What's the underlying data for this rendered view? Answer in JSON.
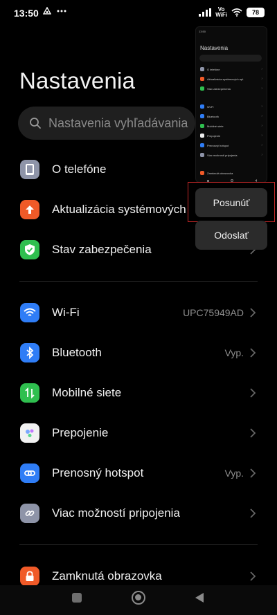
{
  "status_bar": {
    "time": "13:50",
    "network_label_top": "Vo",
    "network_label_bottom": "WiFi",
    "battery": "78"
  },
  "page": {
    "title": "Nastavenia",
    "search_placeholder": "Nastavenia vyhľadávania"
  },
  "sections": [
    {
      "items": [
        {
          "label": "O telefóne",
          "value": "",
          "icon": "phone-icon",
          "color": "#8e94a8"
        },
        {
          "label": "Aktualizácia systémových",
          "value": "",
          "icon": "arrow-up-icon",
          "color": "#f05a28"
        },
        {
          "label": "Stav zabezpečenia",
          "value": "",
          "icon": "shield-check-icon",
          "color": "#2fbf4f"
        }
      ]
    },
    {
      "items": [
        {
          "label": "Wi-Fi",
          "value": "UPC75949AD",
          "icon": "wifi-icon",
          "color": "#2f7df6"
        },
        {
          "label": "Bluetooth",
          "value": "Vyp.",
          "icon": "bluetooth-icon",
          "color": "#2f7df6"
        },
        {
          "label": "Mobilné siete",
          "value": "",
          "icon": "mobile-data-icon",
          "color": "#2fbf4f"
        },
        {
          "label": "Prepojenie",
          "value": "",
          "icon": "connection-icon",
          "color": "#f2f2f2"
        },
        {
          "label": "Prenosný hotspot",
          "value": "Vyp.",
          "icon": "hotspot-icon",
          "color": "#2f7df6"
        },
        {
          "label": "Viac možností pripojenia",
          "value": "",
          "icon": "link-icon",
          "color": "#8e94a8"
        }
      ]
    },
    {
      "items": [
        {
          "label": "Zamknutá obrazovka",
          "value": "",
          "icon": "lock-icon",
          "color": "#f05a28"
        }
      ]
    }
  ],
  "preview": {
    "title": "Nastavenia",
    "rows": [
      "O telefóne",
      "Aktualizácia systémových apl.",
      "Stav zabezpečenia",
      "Wi-Fi",
      "Bluetooth",
      "Mobilné siete",
      "Prepojenie",
      "Prenosný hotspot",
      "Viac možností pripojenia",
      "Zamknutá obrazovka"
    ]
  },
  "popup": {
    "scroll_label": "Posunúť",
    "send_label": "Odoslať"
  },
  "colors": {
    "background": "#000000",
    "highlight": "#c62828"
  }
}
